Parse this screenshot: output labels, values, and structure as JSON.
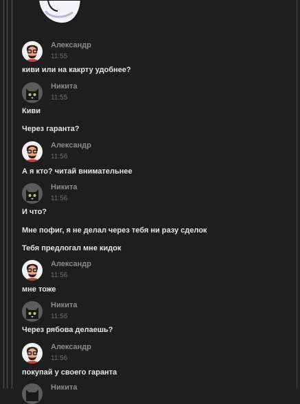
{
  "chat": {
    "messages": [
      {
        "author": "Александр",
        "avatar_icon": "bearded-man-avatar-icon",
        "time": "11:55",
        "lines": [
          "киви или на какрту удобнее?"
        ]
      },
      {
        "author": "Никита",
        "avatar_icon": "cat-avatar-icon",
        "time": "11:55",
        "lines": [
          "Киви",
          "Через гаранта?"
        ]
      },
      {
        "author": "Александр",
        "avatar_icon": "bearded-man-avatar-icon",
        "time": "11:56",
        "lines": [
          "А я кто? читай внимательнее"
        ]
      },
      {
        "author": "Никита",
        "avatar_icon": "cat-avatar-icon",
        "time": "11:56",
        "lines": [
          "И что?",
          "Мне пофиг, я не делал через тебя ни разу сделок",
          "Тебя предлогал мне кидок"
        ]
      },
      {
        "author": "Александр",
        "avatar_icon": "bearded-man-avatar-icon",
        "time": "11:56",
        "lines": [
          "мне тоже"
        ]
      },
      {
        "author": "Никита",
        "avatar_icon": "cat-avatar-icon",
        "time": "11:56",
        "lines": [
          "Через рябова делаешь?"
        ]
      },
      {
        "author": "Александр",
        "avatar_icon": "bearded-man-avatar-icon",
        "time": "11:56",
        "lines": [
          "покупай у своего гаранта"
        ]
      },
      {
        "author": "Никита",
        "avatar_icon": "cat-avatar-icon"
      }
    ],
    "sticker_icon": "cartoon-sticker-icon"
  }
}
